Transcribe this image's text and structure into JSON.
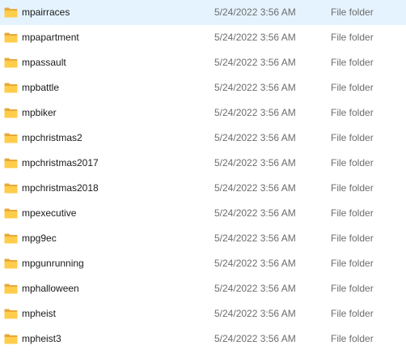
{
  "rows": [
    {
      "name": "mpairraces",
      "date_modified": "5/24/2022 3:56 AM",
      "type": "File folder",
      "icon": "folder-icon"
    },
    {
      "name": "mpapartment",
      "date_modified": "5/24/2022 3:56 AM",
      "type": "File folder",
      "icon": "folder-icon"
    },
    {
      "name": "mpassault",
      "date_modified": "5/24/2022 3:56 AM",
      "type": "File folder",
      "icon": "folder-icon"
    },
    {
      "name": "mpbattle",
      "date_modified": "5/24/2022 3:56 AM",
      "type": "File folder",
      "icon": "folder-icon"
    },
    {
      "name": "mpbiker",
      "date_modified": "5/24/2022 3:56 AM",
      "type": "File folder",
      "icon": "folder-icon"
    },
    {
      "name": "mpchristmas2",
      "date_modified": "5/24/2022 3:56 AM",
      "type": "File folder",
      "icon": "folder-icon"
    },
    {
      "name": "mpchristmas2017",
      "date_modified": "5/24/2022 3:56 AM",
      "type": "File folder",
      "icon": "folder-icon"
    },
    {
      "name": "mpchristmas2018",
      "date_modified": "5/24/2022 3:56 AM",
      "type": "File folder",
      "icon": "folder-icon"
    },
    {
      "name": "mpexecutive",
      "date_modified": "5/24/2022 3:56 AM",
      "type": "File folder",
      "icon": "folder-icon"
    },
    {
      "name": "mpg9ec",
      "date_modified": "5/24/2022 3:56 AM",
      "type": "File folder",
      "icon": "folder-icon"
    },
    {
      "name": "mpgunrunning",
      "date_modified": "5/24/2022 3:56 AM",
      "type": "File folder",
      "icon": "folder-icon"
    },
    {
      "name": "mphalloween",
      "date_modified": "5/24/2022 3:56 AM",
      "type": "File folder",
      "icon": "folder-icon"
    },
    {
      "name": "mpheist",
      "date_modified": "5/24/2022 3:56 AM",
      "type": "File folder",
      "icon": "folder-icon"
    },
    {
      "name": "mpheist3",
      "date_modified": "5/24/2022 3:56 AM",
      "type": "File folder",
      "icon": "folder-icon"
    }
  ],
  "colors": {
    "folder_back": "#e8a93a",
    "folder_front": "#ffcd4a",
    "name_text": "#1a1a1a",
    "meta_text": "#6d6d6d"
  }
}
